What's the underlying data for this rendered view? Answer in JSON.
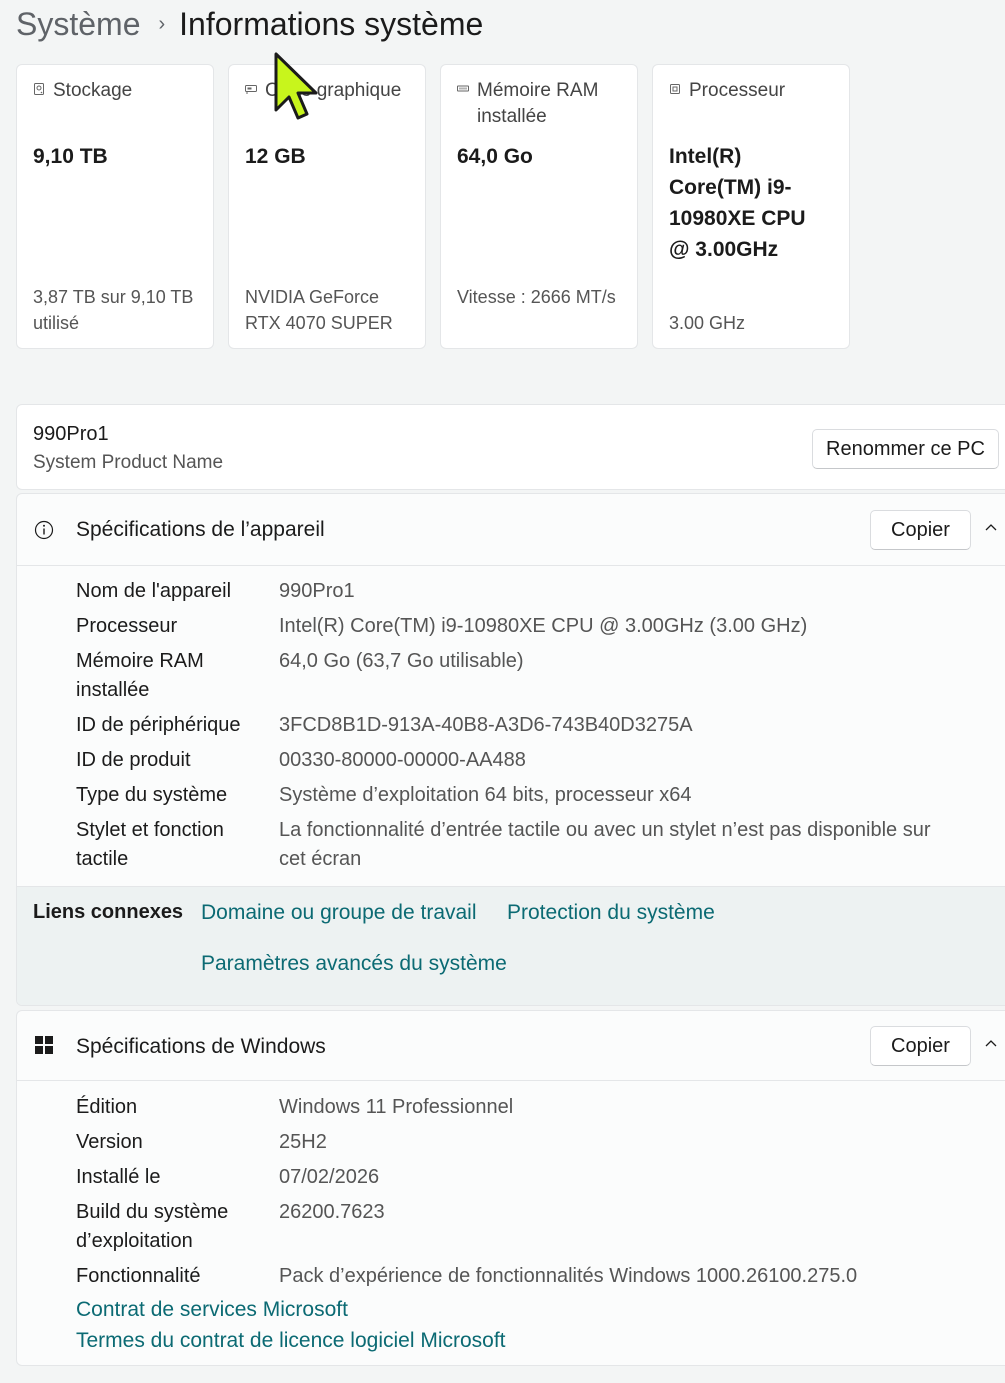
{
  "breadcrumb": {
    "parent": "Système",
    "separator": "›",
    "current": "Informations système"
  },
  "cards": [
    {
      "icon": "storage-icon",
      "title": "Stockage",
      "value": "9,10 TB",
      "sub": "3,87 TB sur 9,10 TB utilisé"
    },
    {
      "icon": "graphics-card-icon",
      "title": "Carte graphique",
      "value": "12 GB",
      "sub": "NVIDIA GeForce RTX 4070 SUPER"
    },
    {
      "icon": "memory-icon",
      "title": "Mémoire RAM installée",
      "value": "64,0 Go",
      "sub": "Vitesse : 2666 MT/s"
    },
    {
      "icon": "processor-icon",
      "title": "Processeur",
      "value": "Intel(R) Core(TM) i9-10980XE CPU @ 3.00GHz",
      "sub": "3.00 GHz"
    }
  ],
  "device": {
    "name": "990Pro1",
    "model": "System Product Name",
    "rename_label": "Renommer ce PC"
  },
  "device_specs": {
    "title": "Spécifications de l’appareil",
    "icon": "info-icon",
    "copy_label": "Copier",
    "rows": [
      {
        "label": "Nom de l'appareil",
        "value": "990Pro1"
      },
      {
        "label": "Processeur",
        "value": "Intel(R) Core(TM) i9-10980XE CPU @ 3.00GHz (3.00 GHz)"
      },
      {
        "label": "Mémoire RAM installée",
        "value": "64,0 Go (63,7 Go utilisable)"
      },
      {
        "label": "ID de périphérique",
        "value": "3FCD8B1D-913A-40B8-A3D6-743B40D3275A"
      },
      {
        "label": "ID de produit",
        "value": "00330-80000-00000-AA488"
      },
      {
        "label": "Type du système",
        "value": "Système d’exploitation 64 bits, processeur x64"
      },
      {
        "label": "Stylet et fonction tactile",
        "value": "La fonctionnalité d’entrée tactile ou avec un stylet n’est pas disponible sur cet écran"
      }
    ]
  },
  "related": {
    "title": "Liens connexes",
    "links": [
      "Domaine ou groupe de travail",
      "Protection du système",
      "Paramètres avancés du système"
    ]
  },
  "windows_specs": {
    "title": "Spécifications de Windows",
    "icon": "windows-logo-icon",
    "copy_label": "Copier",
    "rows": [
      {
        "label": "Édition",
        "value": "Windows 11 Professionnel"
      },
      {
        "label": "Version",
        "value": "25H2"
      },
      {
        "label": "Installé le",
        "value": "07/02/2026"
      },
      {
        "label": "Build du système d’exploitation",
        "value": "26200.7623"
      },
      {
        "label": "Fonctionnalité",
        "value": "Pack d’expérience de fonctionnalités Windows 1000.26100.275.0"
      }
    ],
    "links": [
      "Contrat de services Microsoft",
      "Termes du contrat de licence logiciel Microsoft"
    ]
  },
  "colors": {
    "accent_link": "#0b6a73",
    "cursor": "#c8f51c",
    "page_bg": "#f3f5f5"
  }
}
